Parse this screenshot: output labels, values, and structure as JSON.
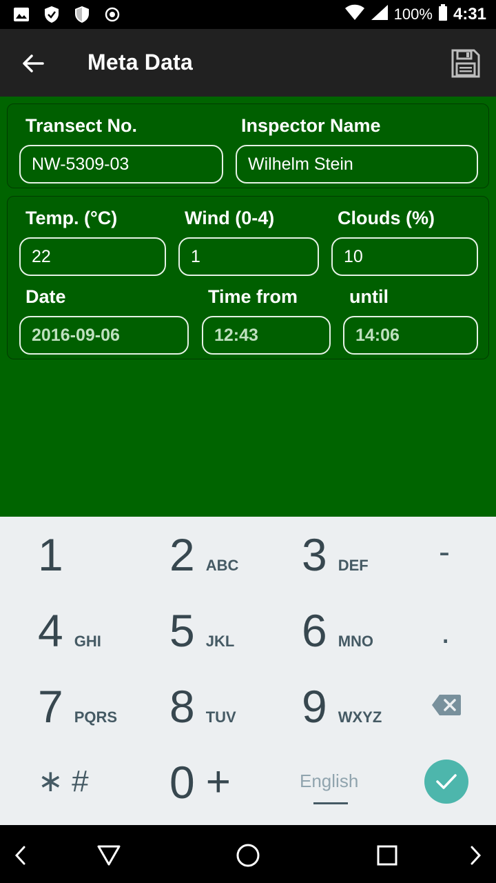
{
  "status_bar": {
    "battery": "100%",
    "time": "4:31"
  },
  "app_bar": {
    "title": "Meta Data"
  },
  "form": {
    "transect_label": "Transect No.",
    "transect_value": "NW-5309-03",
    "inspector_label": "Inspector Name",
    "inspector_value": "Wilhelm Stein",
    "temp_label": "Temp. (°C)",
    "temp_value": "22",
    "wind_label": "Wind (0-4)",
    "wind_value": "1",
    "clouds_label": "Clouds (%)",
    "clouds_value": "10",
    "date_label": "Date",
    "date_value": "2016-09-06",
    "time_from_label": "Time from",
    "time_from_value": "12:43",
    "until_label": "until",
    "until_value": "14:06"
  },
  "keyboard": {
    "keys": [
      {
        "num": "1",
        "sub": ""
      },
      {
        "num": "2",
        "sub": "ABC"
      },
      {
        "num": "3",
        "sub": "DEF"
      },
      {
        "num": "4",
        "sub": "GHI"
      },
      {
        "num": "5",
        "sub": "JKL"
      },
      {
        "num": "6",
        "sub": "MNO"
      },
      {
        "num": "7",
        "sub": "PQRS"
      },
      {
        "num": "8",
        "sub": "TUV"
      },
      {
        "num": "9",
        "sub": "WXYZ"
      },
      {
        "num": "0",
        "sub": "+"
      }
    ],
    "minus": "-",
    "period": ".",
    "star_hash": "∗ #",
    "language": "English"
  },
  "colors": {
    "app_bar": "#212121",
    "content_bg": "#006400",
    "keyboard_bg": "#eceff1",
    "done_button": "#4db6ac"
  }
}
